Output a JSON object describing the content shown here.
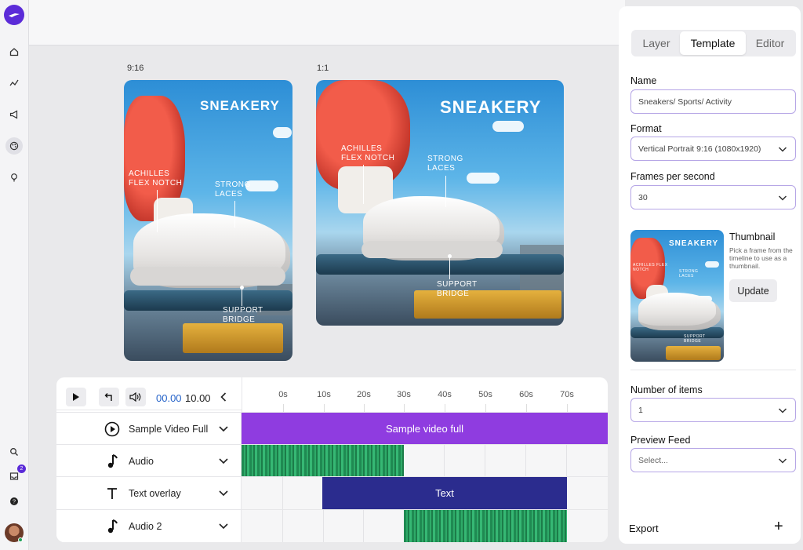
{
  "rail": {
    "notification_count": "2"
  },
  "canvas": {
    "previews": [
      {
        "ratio": "9:16",
        "brand": "SNEAKERY",
        "callouts": [
          "ACHILLES FLEX NOTCH",
          "STRONG LACES",
          "SUPPORT BRIDGE"
        ]
      },
      {
        "ratio": "1:1",
        "brand": "SNEAKERY",
        "callouts": [
          "ACHILLES FLEX NOTCH",
          "STRONG LACES",
          "SUPPORT BRIDGE"
        ]
      }
    ]
  },
  "timeline": {
    "current_time": "00.00",
    "total_time": "10.00",
    "ticks": [
      "0s",
      "10s",
      "20s",
      "30s",
      "40s",
      "50s",
      "60s",
      "70s"
    ],
    "tracks": [
      {
        "name": "Sample Video Full",
        "icon": "play-circle-icon",
        "clip_label": "Sample video full",
        "clip_color": "#8f3ce0"
      },
      {
        "name": "Audio",
        "icon": "music-note-icon",
        "clip_label": "",
        "clip_color": "#2eaa68"
      },
      {
        "name": "Text overlay",
        "icon": "text-icon",
        "clip_label": "Text",
        "clip_color": "#2b2c8e"
      },
      {
        "name": "Audio 2",
        "icon": "music-note-icon",
        "clip_label": "",
        "clip_color": "#2eaa68"
      }
    ]
  },
  "panel": {
    "tabs": [
      "Layer",
      "Template",
      "Editor"
    ],
    "active_tab": "Template",
    "name": {
      "label": "Name",
      "value": "Sneakers/ Sports/ Activity"
    },
    "format": {
      "label": "Format",
      "value": "Vertical Portrait 9:16 (1080x1920)"
    },
    "fps": {
      "label": "Frames per second",
      "value": "30"
    },
    "thumbnail": {
      "title": "Thumbnail",
      "description": "Pick a frame from the timeline to use as a thumbnail.",
      "button": "Update",
      "brand": "SNEAKERY",
      "callouts": [
        "ACHILLES FLEX NOTCH",
        "STRONG LACES",
        "SUPPORT BRIDGE"
      ]
    },
    "items": {
      "label": "Number of items",
      "value": "1"
    },
    "preview_feed": {
      "label": "Preview Feed",
      "placeholder": "Select..."
    },
    "export_label": "Export",
    "export_icon": "+"
  },
  "colors": {
    "accent": "#5b2bd8",
    "video_clip": "#8f3ce0",
    "text_clip": "#2b2c8e",
    "audio_clip": "#2eaa68"
  }
}
